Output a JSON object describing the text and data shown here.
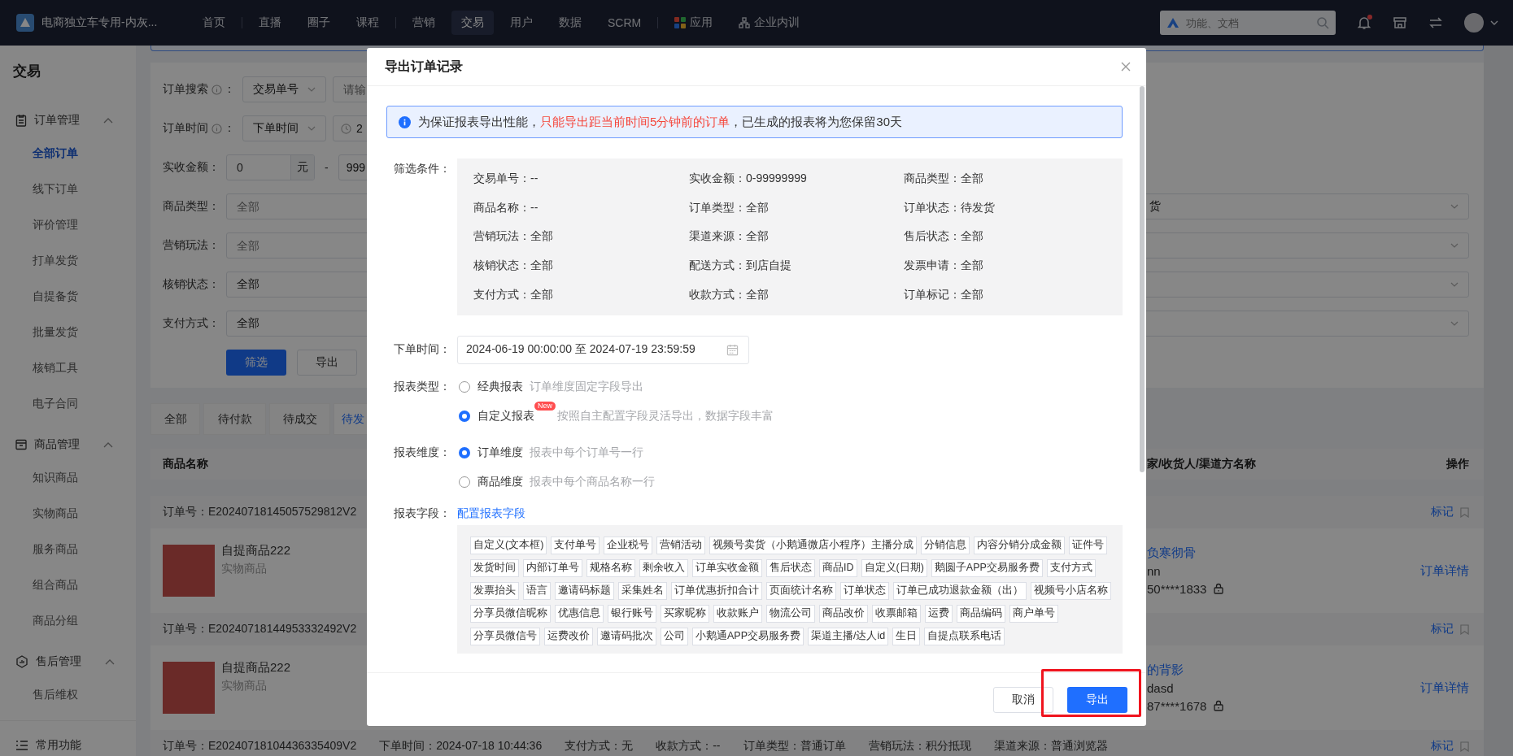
{
  "top_nav": {
    "brand": "电商独立车专用-内灰...",
    "groups": [
      [
        {
          "label": "首页",
          "selected": false,
          "kind": "text"
        }
      ],
      [
        {
          "label": "直播",
          "selected": false,
          "kind": "text"
        },
        {
          "label": "圈子",
          "selected": false,
          "kind": "text"
        },
        {
          "label": "课程",
          "selected": false,
          "kind": "text"
        }
      ],
      [
        {
          "label": "营销",
          "selected": false,
          "kind": "text"
        },
        {
          "label": "交易",
          "selected": true,
          "kind": "text"
        },
        {
          "label": "用户",
          "selected": false,
          "kind": "text"
        },
        {
          "label": "数据",
          "selected": false,
          "kind": "text"
        },
        {
          "label": "SCRM",
          "selected": false,
          "kind": "text"
        }
      ],
      [
        {
          "label": "应用",
          "selected": false,
          "kind": "apps"
        },
        {
          "label": "企业内训",
          "selected": false,
          "kind": "training"
        }
      ]
    ],
    "search": {
      "placeholder": "功能、文档"
    },
    "notifications": {
      "unread": true
    }
  },
  "sidebar": {
    "title": "交易",
    "groups": [
      {
        "label": "订单管理",
        "kind": "orders",
        "expanded": true,
        "items": [
          {
            "label": "全部订单",
            "selected": true
          },
          {
            "label": "线下订单",
            "selected": false
          },
          {
            "label": "评价管理",
            "selected": false
          },
          {
            "label": "打单发货",
            "selected": false
          },
          {
            "label": "自提备货",
            "selected": false
          },
          {
            "label": "批量发货",
            "selected": false
          },
          {
            "label": "核销工具",
            "selected": false
          },
          {
            "label": "电子合同",
            "selected": false
          }
        ]
      },
      {
        "label": "商品管理",
        "kind": "goods",
        "expanded": true,
        "items": [
          {
            "label": "知识商品",
            "selected": false
          },
          {
            "label": "实物商品",
            "selected": false
          },
          {
            "label": "服务商品",
            "selected": false
          },
          {
            "label": "组合商品",
            "selected": false
          },
          {
            "label": "商品分组",
            "selected": false
          }
        ]
      },
      {
        "label": "售后管理",
        "kind": "after-sales",
        "expanded": true,
        "items": [
          {
            "label": "售后维权",
            "selected": false
          }
        ]
      },
      {
        "label": "常用功能",
        "kind": "shortcuts"
      }
    ]
  },
  "filters": {
    "order_search": {
      "label": "订单搜索",
      "suffix": "：",
      "select": "交易单号",
      "placeholder": "请输"
    },
    "order_time": {
      "label": "订单时间",
      "suffix": "：",
      "select": "下单时间",
      "value": "2"
    },
    "amount": {
      "label": "实收金额：",
      "min": "0",
      "unit": "元",
      "separator": "-",
      "max": "999"
    },
    "rows": [
      {
        "label": "商品类型：",
        "placeholder": "全部",
        "right_value": "货"
      },
      {
        "label": "营销玩法：",
        "placeholder": "全部"
      },
      {
        "label": "核销状态：",
        "value": "全部"
      },
      {
        "label": "支付方式：",
        "value": "全部"
      }
    ],
    "buttons": [
      {
        "label": "筛选",
        "kind": "primary"
      },
      {
        "label": "导出",
        "kind": "default"
      }
    ]
  },
  "order_tabs": [
    {
      "label": "全部",
      "selected": false
    },
    {
      "label": "待付款",
      "selected": false
    },
    {
      "label": "待成交",
      "selected": false
    },
    {
      "label": "待发",
      "selected": true
    }
  ],
  "table": {
    "columns": [
      "商品名称",
      "家/收货人/渠道方名称",
      "操作"
    ],
    "orders": [
      {
        "order_no": "订单号：E20240718145057529812V2",
        "mark_link": "标记",
        "product": {
          "name": "自提商品222",
          "type": "实物商品"
        },
        "buyer": [
          {
            "text": "负寒彻骨",
            "kind": "link"
          },
          {
            "text": "nn",
            "kind": "text"
          },
          {
            "text": "50****1833",
            "kind": "phone"
          }
        ],
        "detail_link": "订单详情"
      },
      {
        "order_no": "订单号：E20240718144953332492V2",
        "mark_link": "标记",
        "product": {
          "name": "自提商品222",
          "type": "实物商品"
        },
        "buyer": [
          {
            "text": "的背影",
            "kind": "link"
          },
          {
            "text": "dasd",
            "kind": "text"
          },
          {
            "text": "87****1678",
            "kind": "phone"
          }
        ],
        "detail_link": "订单详情"
      },
      {
        "order_no": "订单号：E20240718104436335409V2",
        "mark_link": "标记",
        "meta": [
          "下单时间：2024-07-18 10:44:36",
          "支付方式：无",
          "收款方式：--",
          "订单类型：普通订单",
          "营销玩法：积分抵现",
          "渠道来源：普通浏览器"
        ]
      }
    ]
  },
  "dialog": {
    "title": "导出订单记录",
    "notice": {
      "before": "为保证报表导出性能，",
      "highlight": "只能导出距当前时间5分钟前的订单",
      "after": "，已生成的报表将为您保留30天"
    },
    "filter_summary": {
      "label": "筛选条件：",
      "items": [
        "交易单号：--",
        "实收金额：0-99999999",
        "商品类型：全部",
        "商品名称：--",
        "订单类型：全部",
        "订单状态：待发货",
        "营销玩法：全部",
        "渠道来源：全部",
        "售后状态：全部",
        "核销状态：全部",
        "配送方式：到店自提",
        "发票申请：全部",
        "支付方式：全部",
        "收款方式：全部",
        "订单标记：全部"
      ]
    },
    "order_time": {
      "label": "下单时间：",
      "value": "2024-06-19 00:00:00 至 2024-07-19 23:59:59"
    },
    "report_type": {
      "label": "报表类型：",
      "options": [
        {
          "label": "经典报表",
          "description": "订单维度固定字段导出",
          "selected": false
        },
        {
          "label": "自定义报表",
          "badge": "New",
          "description": "按照自主配置字段灵活导出，数据字段丰富",
          "selected": true
        }
      ]
    },
    "report_dimension": {
      "label": "报表维度：",
      "options": [
        {
          "label": "订单维度",
          "description": "报表中每个订单号一行",
          "selected": true
        },
        {
          "label": "商品维度",
          "description": "报表中每个商品名称一行",
          "selected": false
        }
      ]
    },
    "report_fields": {
      "label": "报表字段：",
      "link": "配置报表字段",
      "fields": [
        "自定义(文本框)",
        "支付单号",
        "企业税号",
        "营销活动",
        "视频号卖货（小鹅通微店小程序）主播分成",
        "分销信息",
        "内容分销分成金额",
        "证件号",
        "发货时间",
        "内部订单号",
        "规格名称",
        "剩余收入",
        "订单实收金额",
        "售后状态",
        "商品ID",
        "自定义(日期)",
        "鹅圆子APP交易服务费",
        "支付方式",
        "发票抬头",
        "语言",
        "邀请码标题",
        "采集姓名",
        "订单优惠折扣合计",
        "页面统计名称",
        "订单状态",
        "订单已成功退款金额（出）",
        "视频号小店名称",
        "分享员微信昵称",
        "优惠信息",
        "银行账号",
        "买家昵称",
        "收款账户",
        "物流公司",
        "商品改价",
        "收票邮箱",
        "运费",
        "商品编码",
        "商户单号",
        "分享员微信号",
        "运费改价",
        "邀请码批次",
        "公司",
        "小鹅通APP交易服务费",
        "渠道主播/达人id",
        "生日",
        "自提点联系电话"
      ]
    },
    "buttons": [
      {
        "label": "取消",
        "kind": "default",
        "highlighted": false
      },
      {
        "label": "导出",
        "kind": "primary",
        "highlighted": true
      }
    ]
  }
}
